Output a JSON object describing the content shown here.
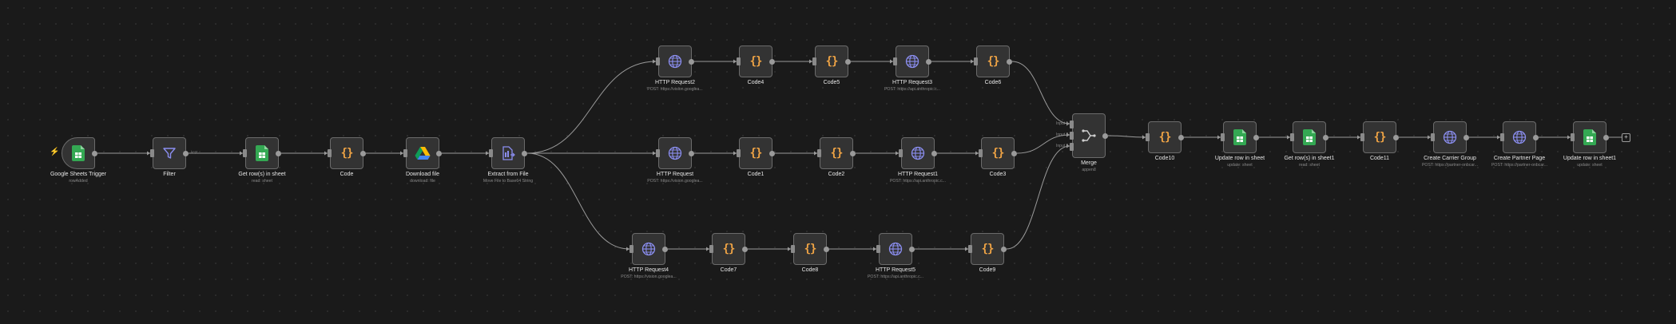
{
  "canvas": {
    "colors": {
      "background": "#1a1a1a",
      "node": "#333333",
      "node_border": "#6b6b6b",
      "edge": "#9a9a9a",
      "accent_orange": "#f0a445",
      "sheets_green": "#34a853",
      "http_purple": "#8b8ef0"
    }
  },
  "nodes": [
    {
      "id": "n1",
      "kind": "sheets-trigger",
      "icon": "google-sheets-icon",
      "title": "Google Sheets Trigger",
      "subtitle": "rowAdded"
    },
    {
      "id": "n2",
      "kind": "filter",
      "icon": "filter-icon",
      "title": "Filter",
      "subtitle": ""
    },
    {
      "id": "n3",
      "kind": "sheets",
      "icon": "google-sheets-icon",
      "title": "Get row(s) in sheet",
      "subtitle": "read: sheet"
    },
    {
      "id": "n4",
      "kind": "code",
      "icon": "code-braces-icon",
      "title": "Code",
      "subtitle": ""
    },
    {
      "id": "n5",
      "kind": "drive",
      "icon": "google-drive-icon",
      "title": "Download file",
      "subtitle": "download: file"
    },
    {
      "id": "n6",
      "kind": "extract",
      "icon": "extract-file-icon",
      "title": "Extract from File",
      "subtitle": "Move File to Base64 String"
    },
    {
      "id": "n7",
      "kind": "http",
      "icon": "globe-icon",
      "title": "HTTP Request2",
      "subtitle": "POST: https://vision.googlea..."
    },
    {
      "id": "n8",
      "kind": "code",
      "icon": "code-braces-icon",
      "title": "Code4",
      "subtitle": ""
    },
    {
      "id": "n9",
      "kind": "code",
      "icon": "code-braces-icon",
      "title": "Code5",
      "subtitle": ""
    },
    {
      "id": "n10",
      "kind": "http",
      "icon": "globe-icon",
      "title": "HTTP Request3",
      "subtitle": "POST: https://api.anthropic.c..."
    },
    {
      "id": "n11",
      "kind": "code",
      "icon": "code-braces-icon",
      "title": "Code6",
      "subtitle": ""
    },
    {
      "id": "n12",
      "kind": "http",
      "icon": "globe-icon",
      "title": "HTTP Request",
      "subtitle": "POST: https://vision.googlea..."
    },
    {
      "id": "n13",
      "kind": "code",
      "icon": "code-braces-icon",
      "title": "Code1",
      "subtitle": ""
    },
    {
      "id": "n14",
      "kind": "code",
      "icon": "code-braces-icon",
      "title": "Code2",
      "subtitle": ""
    },
    {
      "id": "n15",
      "kind": "http",
      "icon": "globe-icon",
      "title": "HTTP Request1",
      "subtitle": "POST: https://api.anthropic.c..."
    },
    {
      "id": "n16",
      "kind": "code",
      "icon": "code-braces-icon",
      "title": "Code3",
      "subtitle": ""
    },
    {
      "id": "n17",
      "kind": "http",
      "icon": "globe-icon",
      "title": "HTTP Request4",
      "subtitle": "POST: https://vision.googlea..."
    },
    {
      "id": "n18",
      "kind": "code",
      "icon": "code-braces-icon",
      "title": "Code7",
      "subtitle": ""
    },
    {
      "id": "n19",
      "kind": "code",
      "icon": "code-braces-icon",
      "title": "Code8",
      "subtitle": ""
    },
    {
      "id": "n20",
      "kind": "http",
      "icon": "globe-icon",
      "title": "HTTP Request5",
      "subtitle": "POST: https://api.anthropic.c..."
    },
    {
      "id": "n21",
      "kind": "code",
      "icon": "code-braces-icon",
      "title": "Code9",
      "subtitle": ""
    },
    {
      "id": "n22",
      "kind": "merge",
      "icon": "merge-icon",
      "title": "Merge",
      "subtitle": "append",
      "inputs": [
        "Input 1",
        "Input 2",
        "Input 3"
      ]
    },
    {
      "id": "n23",
      "kind": "code",
      "icon": "code-braces-icon",
      "title": "Code10",
      "subtitle": ""
    },
    {
      "id": "n24",
      "kind": "sheets",
      "icon": "google-sheets-icon",
      "title": "Update row in sheet",
      "subtitle": "update: sheet"
    },
    {
      "id": "n25",
      "kind": "sheets",
      "icon": "google-sheets-icon",
      "title": "Get row(s) in sheet1",
      "subtitle": "read: sheet"
    },
    {
      "id": "n26",
      "kind": "code",
      "icon": "code-braces-icon",
      "title": "Code11",
      "subtitle": ""
    },
    {
      "id": "n27",
      "kind": "http",
      "icon": "globe-icon",
      "title": "Create Carrier Group",
      "subtitle": "POST: https://partner-onbcar..."
    },
    {
      "id": "n28",
      "kind": "http",
      "icon": "globe-icon",
      "title": "Create Partner Page",
      "subtitle": "POST: https://partner-onbcar..."
    },
    {
      "id": "n29",
      "kind": "sheets",
      "icon": "google-sheets-icon",
      "title": "Update row in sheet1",
      "subtitle": "update: sheet"
    }
  ],
  "filter_edge_label": "kept",
  "add_node_label": "+"
}
